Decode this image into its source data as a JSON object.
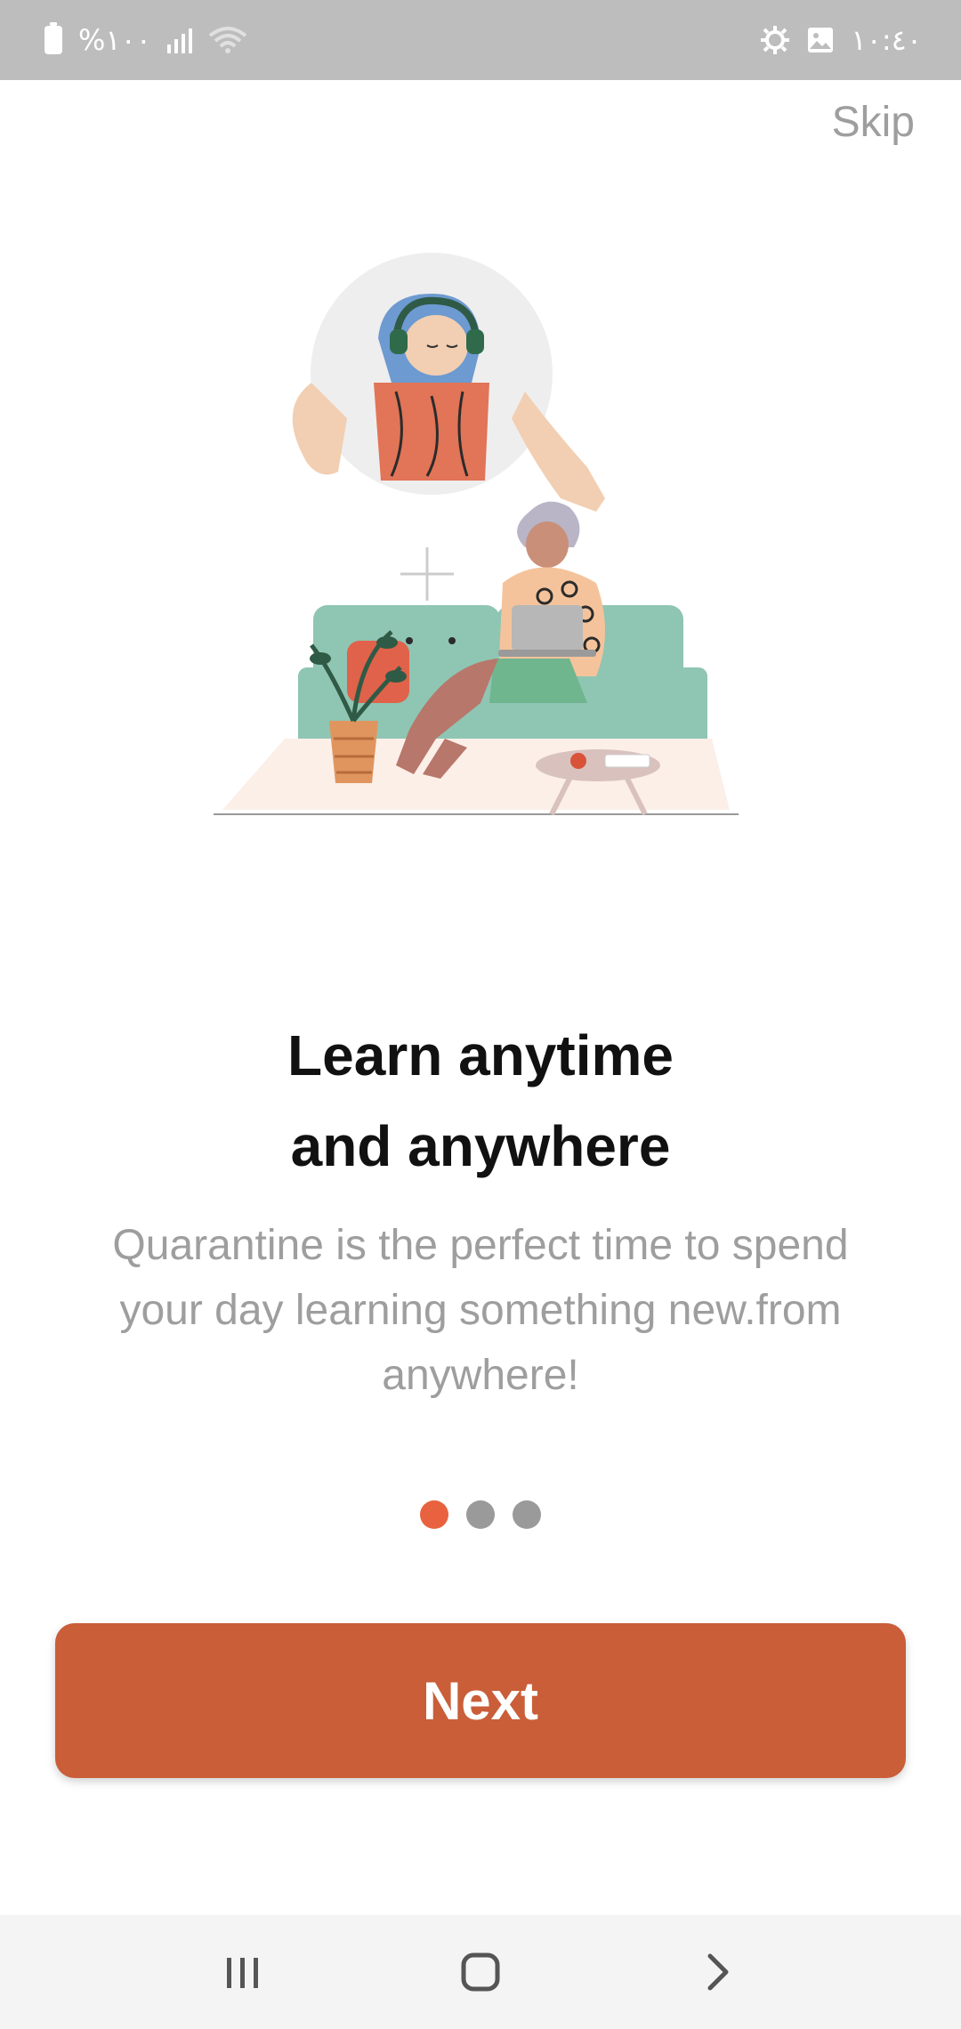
{
  "status_bar": {
    "battery_text": "%١٠٠",
    "time": "١٠:٤٠",
    "icons": [
      "battery-icon",
      "signal-icon",
      "wifi-icon",
      "settings-icon",
      "gallery-icon"
    ]
  },
  "skip_label": "Skip",
  "onboarding": {
    "title_line1": "Learn anytime",
    "title_line2": "and anywhere",
    "description": "Quarantine is the perfect time to spend your day learning something new.from anywhere!",
    "page_indicator": {
      "current": 1,
      "total": 3
    }
  },
  "next_label": "Next",
  "nav_bar": {
    "icons": [
      "recent-apps-icon",
      "home-icon",
      "back-icon"
    ]
  },
  "colors": {
    "accent": "#c95e39",
    "active_dot": "#e8623f",
    "inactive_dot": "#9a9a9a",
    "status_bar": "#bdbdbd"
  }
}
